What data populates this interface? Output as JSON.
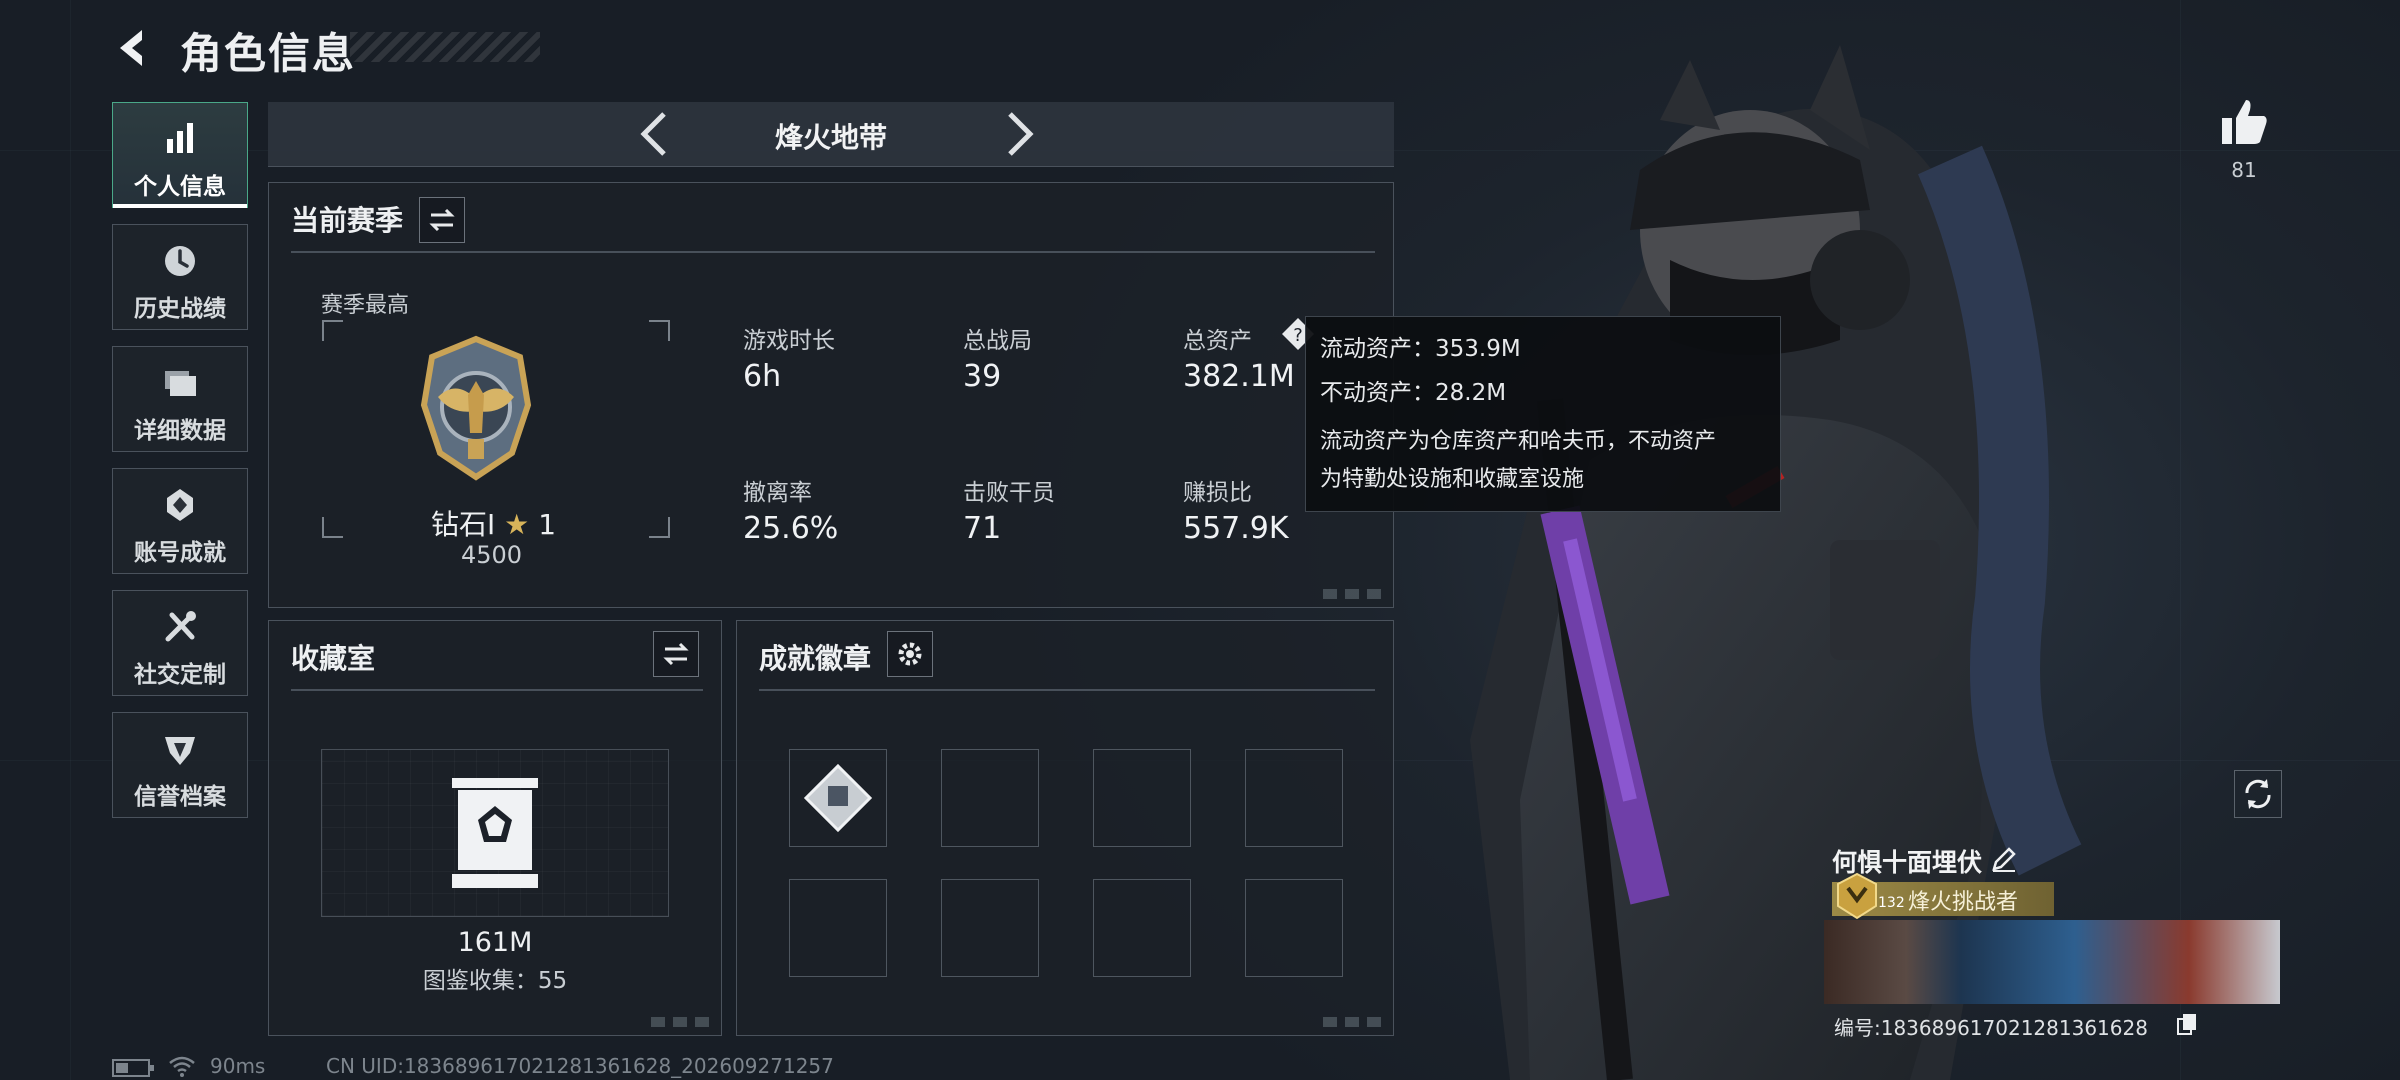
{
  "header": {
    "title": "角色信息"
  },
  "sidebar": {
    "items": [
      {
        "label": "个人信息",
        "icon": "bar-chart-icon",
        "active": true
      },
      {
        "label": "历史战绩",
        "icon": "history-clock-icon"
      },
      {
        "label": "详细数据",
        "icon": "folder-icon"
      },
      {
        "label": "账号成就",
        "icon": "achievement-icon"
      },
      {
        "label": "社交定制",
        "icon": "tools-icon"
      },
      {
        "label": "信誉档案",
        "icon": "credit-shield-icon"
      }
    ]
  },
  "mode": {
    "title": "烽火地带"
  },
  "season": {
    "title": "当前赛季",
    "best_label": "赛季最高",
    "rank_name": "钻石Ⅰ",
    "rank_stars": "1",
    "rank_points": "4500",
    "stats": [
      {
        "label": "游戏时长",
        "value": "6h"
      },
      {
        "label": "总战局",
        "value": "39"
      },
      {
        "label": "总资产",
        "value": "382.1M"
      },
      {
        "label": "撤离率",
        "value": "25.6%"
      },
      {
        "label": "击败干员",
        "value": "71"
      },
      {
        "label": "赚损比",
        "value": "557.9K"
      }
    ]
  },
  "tooltip": {
    "liquid": "流动资产：353.9M",
    "fixed": "不动资产：28.2M",
    "desc1": "流动资产为仓库资产和哈夫币，不动资产",
    "desc2": "为特勤处设施和收藏室设施"
  },
  "collection": {
    "title": "收藏室",
    "value": "161M",
    "catalog": "图鉴收集：55"
  },
  "badges": {
    "title": "成就徽章"
  },
  "likes": {
    "count": "81"
  },
  "player": {
    "name": "何惧十面埋伏",
    "level": "132",
    "title_tag": "烽火挑战者",
    "id_label": "编号:1836896170212813616 28",
    "id_text": "编号:183689617021281361628"
  },
  "footer": {
    "ping": "90ms",
    "uid": "CN UID:183689617021281361628_202609271257"
  },
  "colors": {
    "accent": "#4aa888",
    "gold": "#c8a84e",
    "panel_border": "#4a525c"
  }
}
